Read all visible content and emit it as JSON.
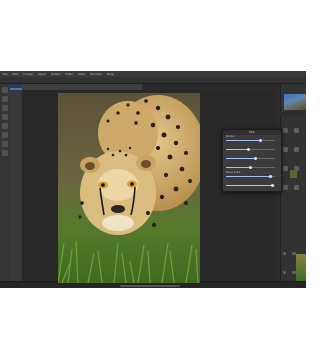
{
  "menu": [
    "File",
    "Edit",
    "Image",
    "Layer",
    "Select",
    "Filter",
    "View",
    "Window",
    "Help"
  ],
  "options_label": "",
  "document_tab": "",
  "status_text": "",
  "dialog": {
    "title": "Filter",
    "adjustments": [
      {
        "label": "Radius",
        "value": 0.7
      },
      {
        "label": "",
        "value": 0.45
      },
      {
        "label": "",
        "value": 0.6
      },
      {
        "label": "",
        "value": 0.5
      },
      {
        "label": "Noise Scale",
        "value": 0.9
      },
      {
        "label": "",
        "value": 0.95
      }
    ],
    "checkbox_label": ""
  },
  "right_panel": {
    "navigator_title": "",
    "tabs_label": ""
  },
  "colors": {
    "accent": "#2c7be5",
    "app_bg": "#2b2b2b"
  }
}
